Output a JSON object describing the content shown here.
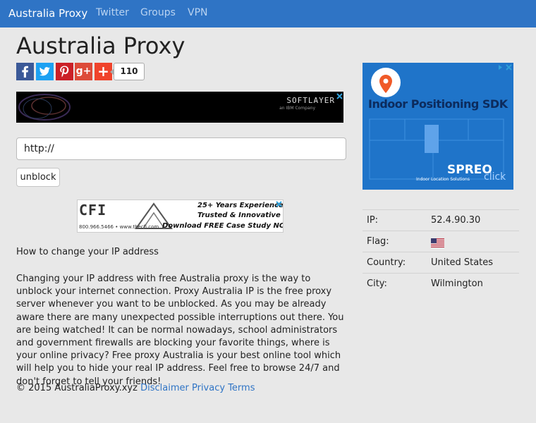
{
  "nav": {
    "brand": "Australia Proxy",
    "links": [
      "Twitter",
      "Groups",
      "VPN"
    ]
  },
  "page_title": "Australia Proxy",
  "share": {
    "google_plus": "g+",
    "add": "+",
    "count": "110",
    "icons": [
      "facebook-icon",
      "twitter-icon",
      "pinterest-icon",
      "google-plus-icon",
      "add-share-icon"
    ]
  },
  "ads": {
    "banner": {
      "brand": "SOFTLAYER",
      "tagline": "an IBM Company"
    },
    "cfi": {
      "logo": "CFI",
      "line1": "25+ Years Experience",
      "line2": "Trusted & Innovative",
      "line3": "Download FREE Case Study NOW!",
      "phone": "800.966.5466 • www.thecfi.com"
    },
    "indoor": {
      "headline": "Indoor Positioning SDK",
      "brand": "SPREO",
      "click": "click",
      "sub": "Indoor Location Solutions"
    }
  },
  "url_input": {
    "value": "http://"
  },
  "unblock_label": "unblock",
  "how_to_title": "How to change your IP address",
  "description": "Changing your IP address with free Australia proxy is the way to unblock your internet connection. Proxy Australia IP is the free proxy server whenever you want to be unblocked. As you may be already aware there are many unexpected possible interruptions out there. You are being watched! It can be normal nowadays, school administrators and government firewalls are blocking your favorite things, where is your online privacy? Free proxy Australia is your best online tool which will help you to hide your real IP address. Feel free to browse 24/7 and don't forget to tell your friends!",
  "footer": {
    "copyright": "© 2015 AustraliaProxy.xyz",
    "links": [
      "Disclaimer",
      "Privacy",
      "Terms"
    ]
  },
  "ip_info": {
    "rows": [
      {
        "key": "IP:",
        "value": "52.4.90.30"
      },
      {
        "key": "Flag:",
        "value": ""
      },
      {
        "key": "Country:",
        "value": "United States"
      },
      {
        "key": "City:",
        "value": "Wilmington"
      }
    ]
  },
  "colors": {
    "nav_bg": "#2f74c5",
    "facebook": "#3b5998",
    "twitter": "#1da1f2",
    "pinterest": "#cb2027",
    "google_plus": "#dd4b39",
    "add": "#f0432b"
  }
}
